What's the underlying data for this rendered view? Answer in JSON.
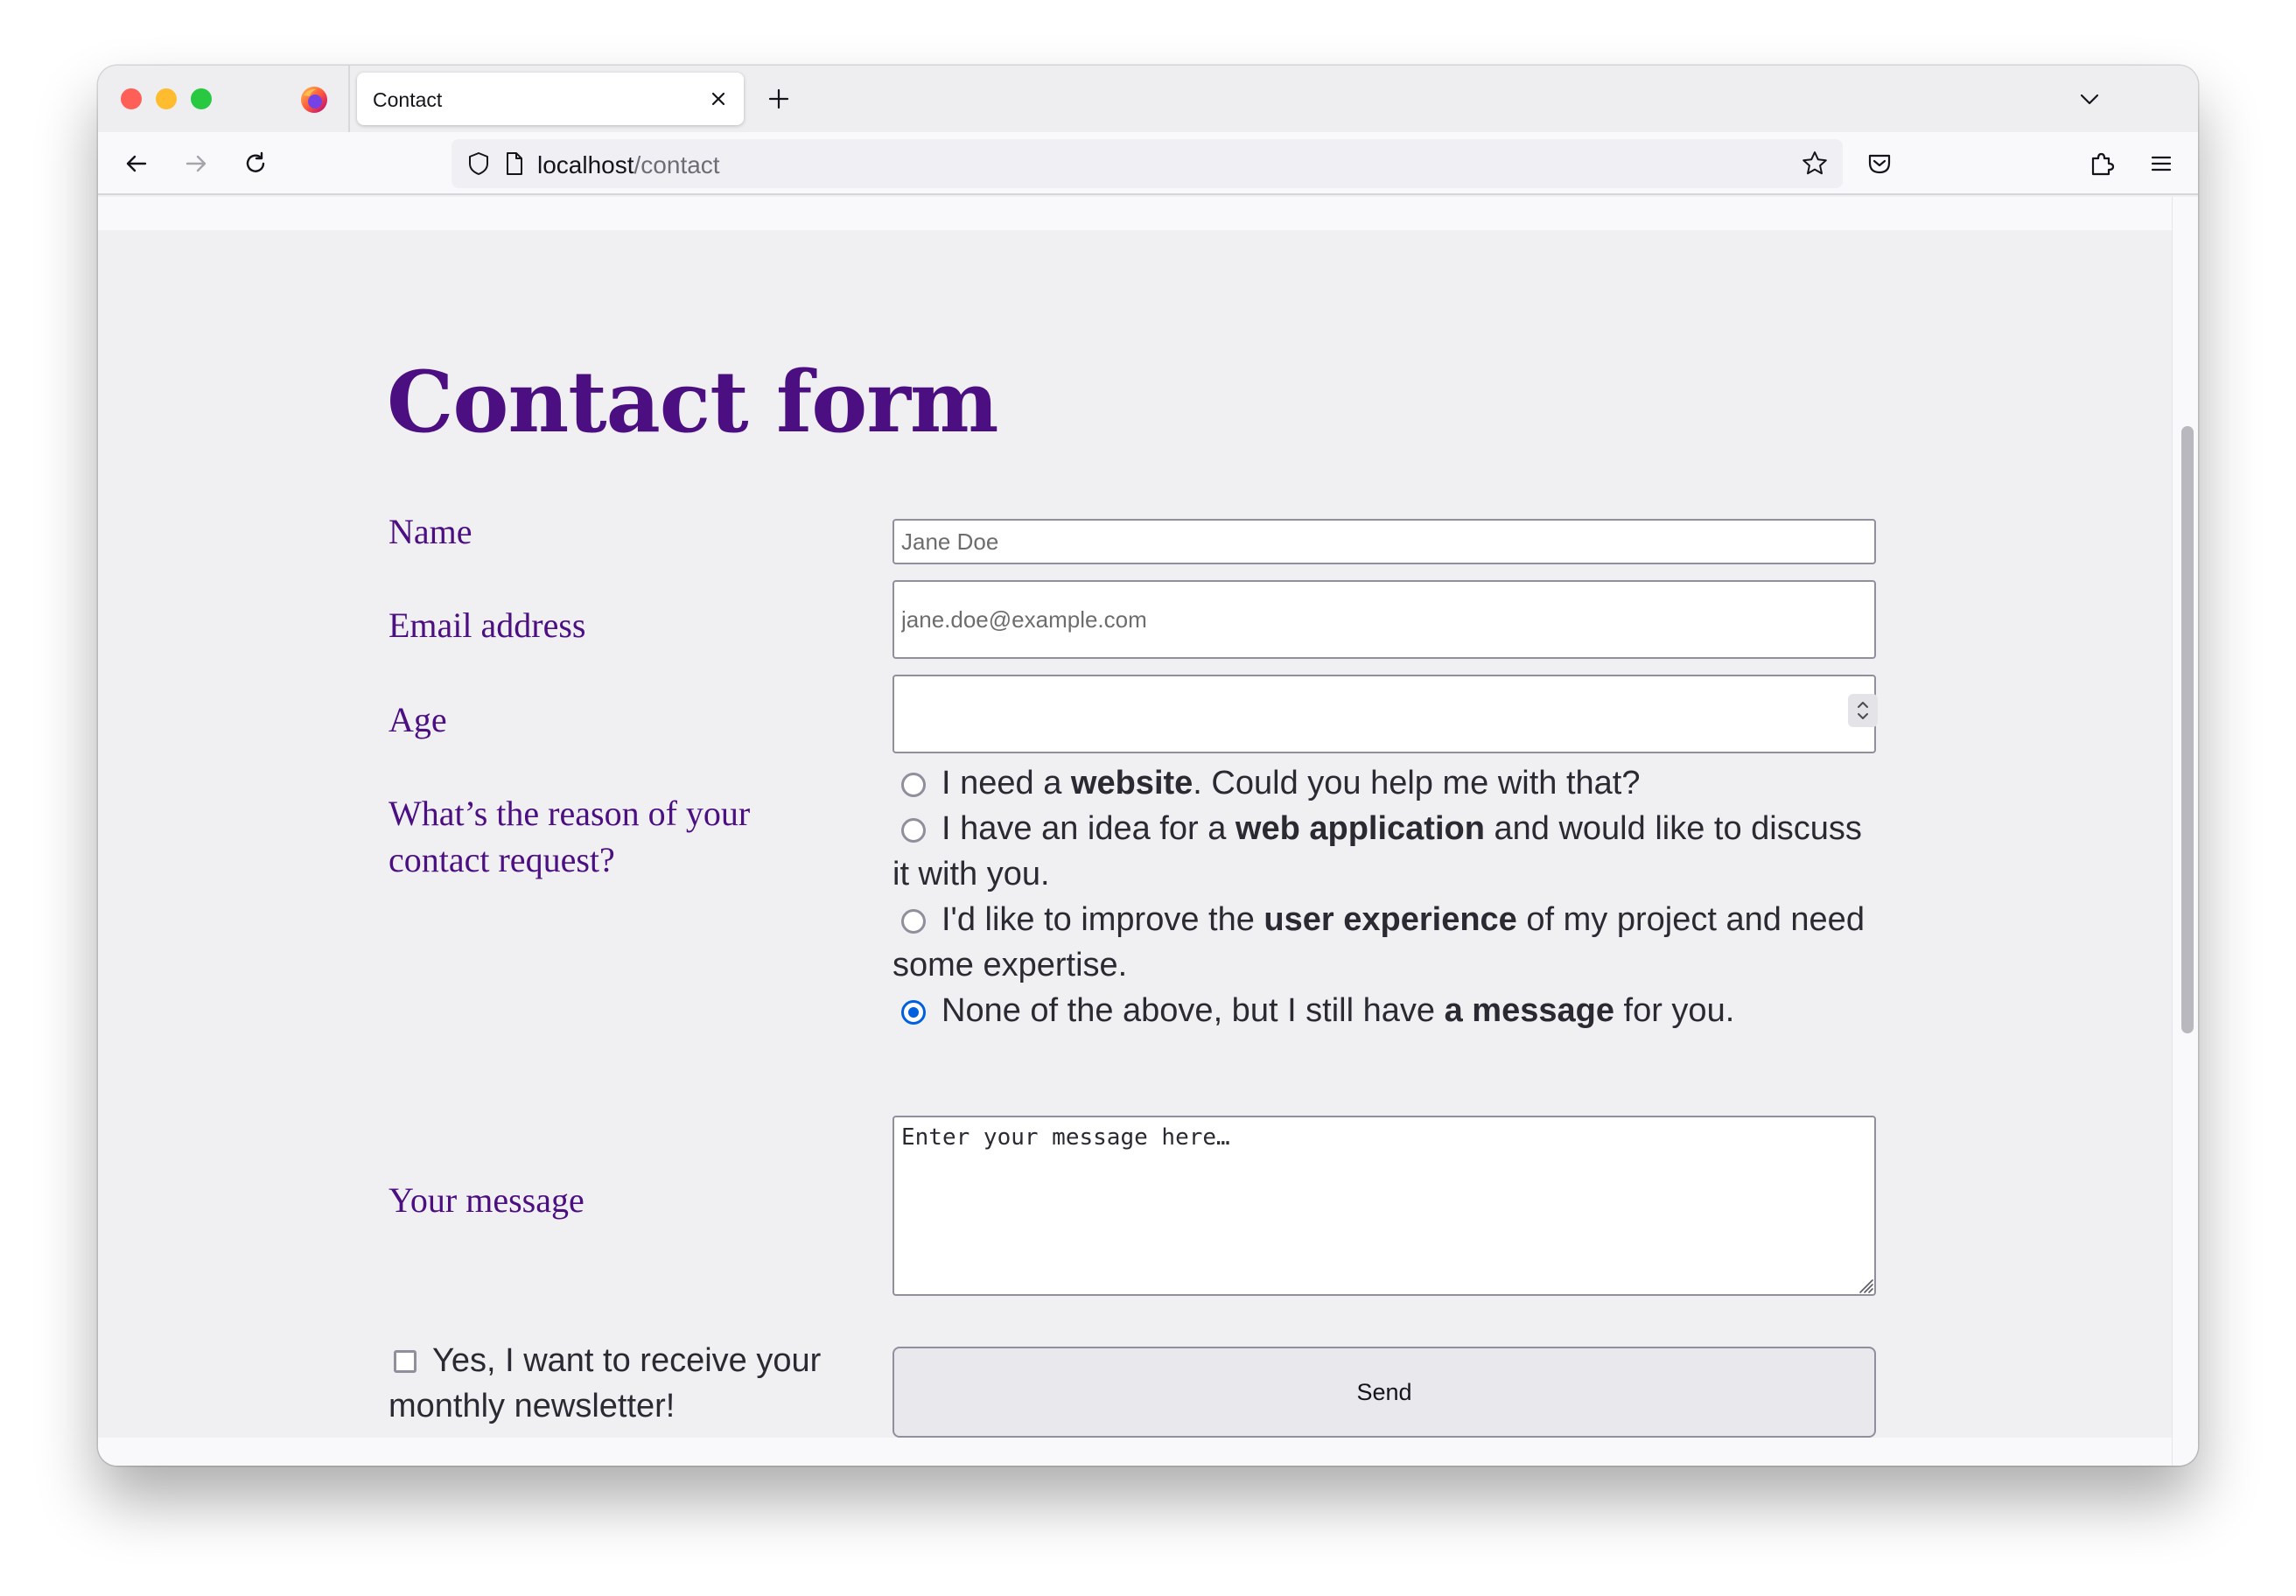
{
  "browser": {
    "tab_title": "Contact",
    "url_host": "localhost",
    "url_path": "/contact"
  },
  "icons": {
    "browser": "firefox-icon",
    "tab_close": "close-icon",
    "new_tab": "plus-icon",
    "tab_list": "chevron-down-icon",
    "back": "arrow-left-icon",
    "forward": "arrow-right-icon",
    "reload": "reload-icon",
    "security": "shield-icon",
    "page": "page-icon",
    "bookmark": "star-icon",
    "pocket": "pocket-icon",
    "extensions": "puzzle-icon",
    "menu": "hamburger-icon"
  },
  "form": {
    "title": "Contact form",
    "name_label": "Name",
    "name_placeholder": "Jane Doe",
    "email_label": "Email address",
    "email_placeholder": "jane.doe@example.com",
    "age_label": "Age",
    "reason_label": "What’s the reason of your contact request?",
    "reasons": [
      {
        "before": "I need a ",
        "bold": "website",
        "after": ". Could you help me with that?",
        "checked": false
      },
      {
        "before": "I have an idea for a ",
        "bold": "web application",
        "after": " and would like to discuss it with you.",
        "checked": false
      },
      {
        "before": "I'd like to improve the ",
        "bold": "user experience",
        "after": " of my project and need some expertise.",
        "checked": false
      },
      {
        "before": "None of the above, but I still have ",
        "bold": "a message",
        "after": " for you.",
        "checked": true
      }
    ],
    "message_label": "Your message",
    "message_placeholder": "Enter your message here…",
    "newsletter_label": "Yes, I want to receive your monthly newsletter!",
    "newsletter_checked": false,
    "send_label": "Send"
  },
  "colors": {
    "accent": "#4b0f82",
    "radio_checked": "#0060df"
  }
}
